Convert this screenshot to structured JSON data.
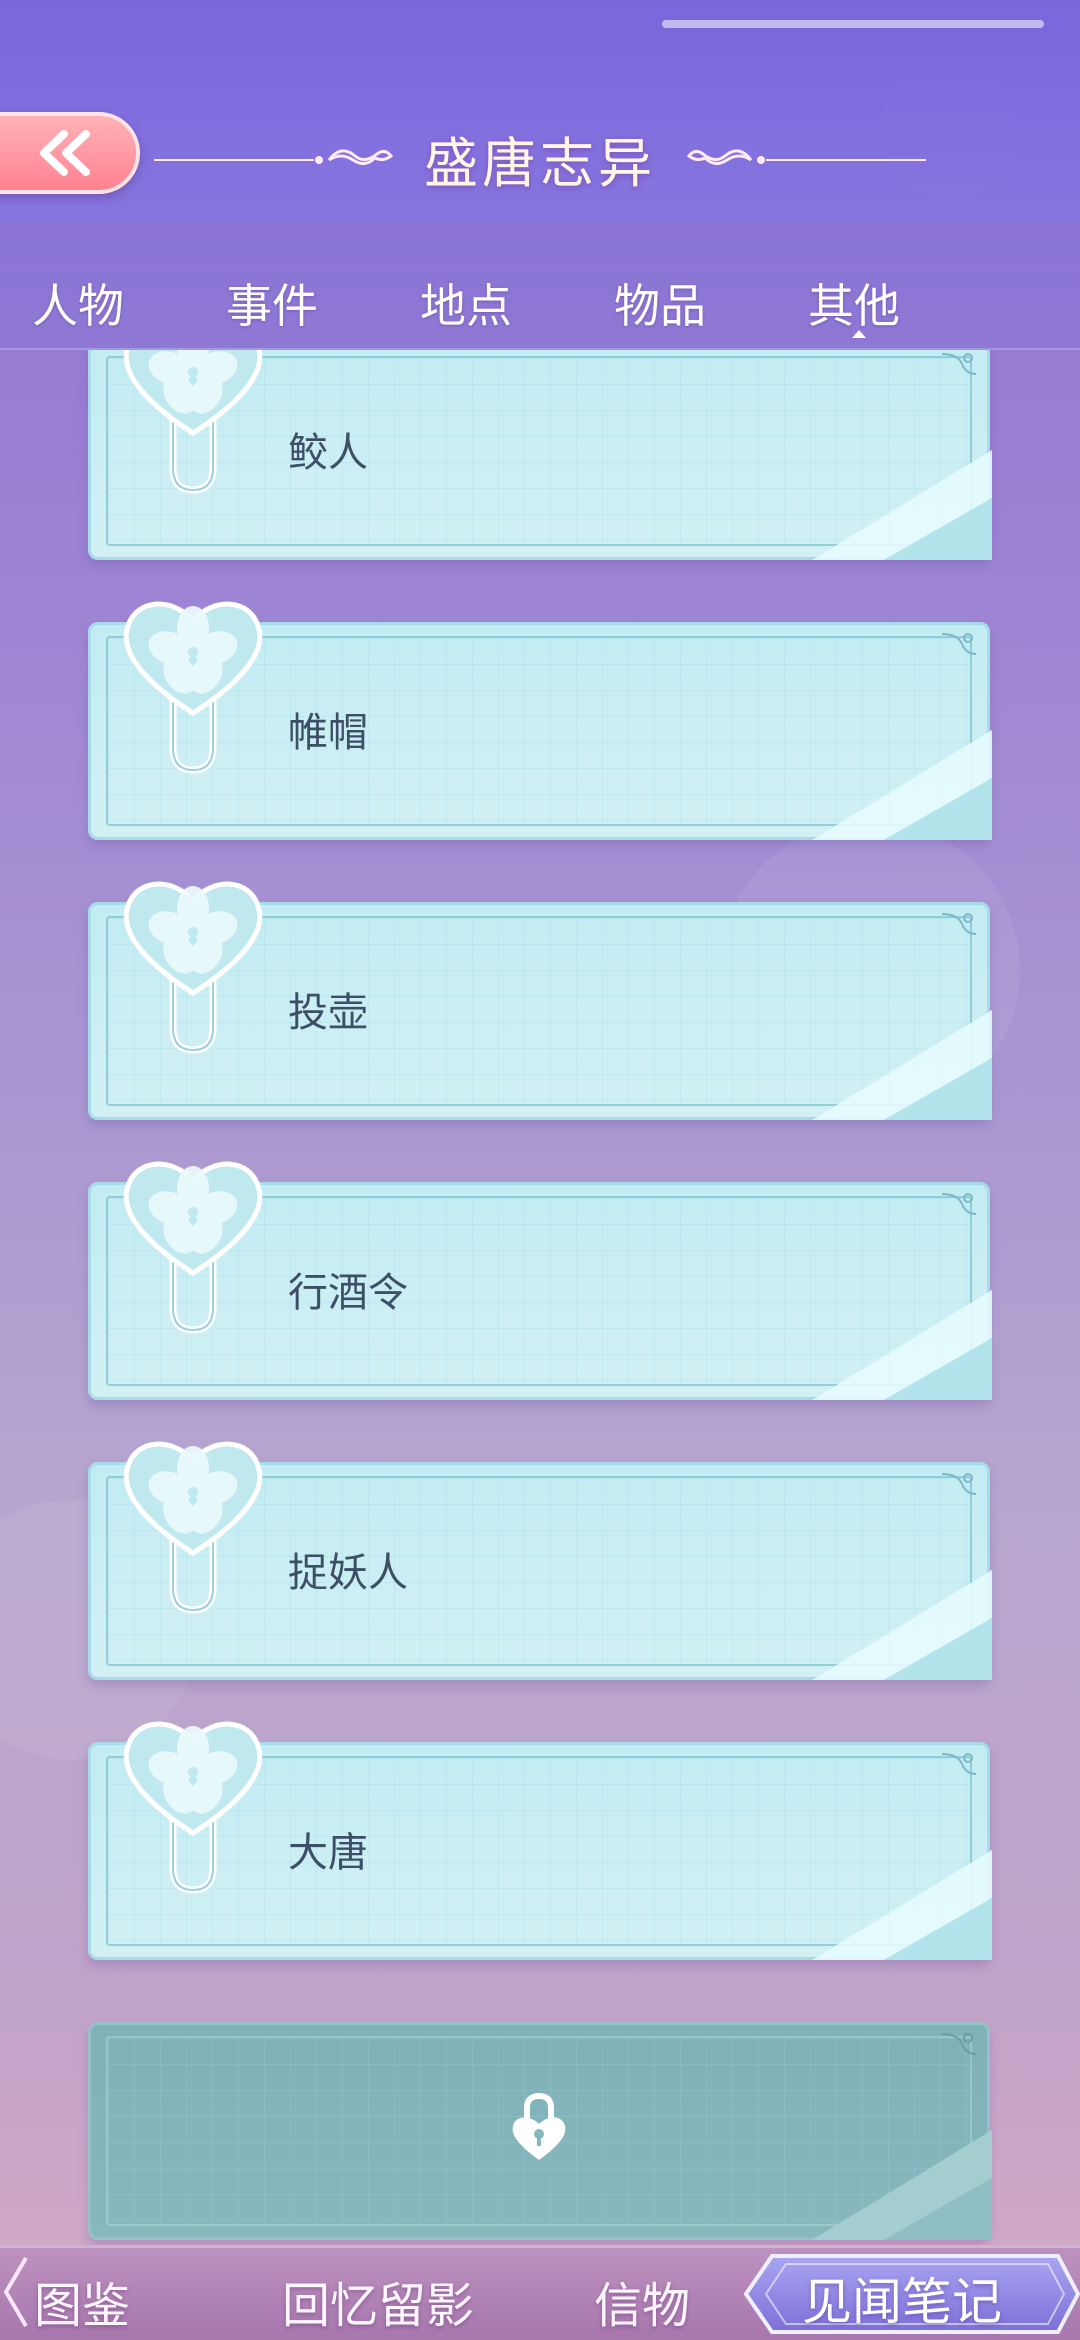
{
  "header": {
    "title": "盛唐志异",
    "back_icon": "double-chevron-left-icon"
  },
  "tabs": [
    {
      "label": "人物",
      "active": false
    },
    {
      "label": "事件",
      "active": false
    },
    {
      "label": "地点",
      "active": false
    },
    {
      "label": "物品",
      "active": false
    },
    {
      "label": "其他",
      "active": true
    }
  ],
  "entries": [
    {
      "label": "鲛人",
      "locked": false
    },
    {
      "label": "帷帽",
      "locked": false
    },
    {
      "label": "投壶",
      "locked": false
    },
    {
      "label": "行酒令",
      "locked": false
    },
    {
      "label": "捉妖人",
      "locked": false
    },
    {
      "label": "大唐",
      "locked": false
    },
    {
      "label": "",
      "locked": true,
      "icon": "heart-lock-icon"
    }
  ],
  "bottom_nav": [
    {
      "label": "图鉴",
      "active": false
    },
    {
      "label": "回忆留影",
      "active": false
    },
    {
      "label": "信物",
      "active": false
    },
    {
      "label": "见闻笔记",
      "active": true
    }
  ],
  "colors": {
    "card": "#c2ecf3",
    "card_locked": "#7fb1b7",
    "header": "#7866dc",
    "back_button": "#ff8290",
    "label_text": "#3c4f66"
  }
}
